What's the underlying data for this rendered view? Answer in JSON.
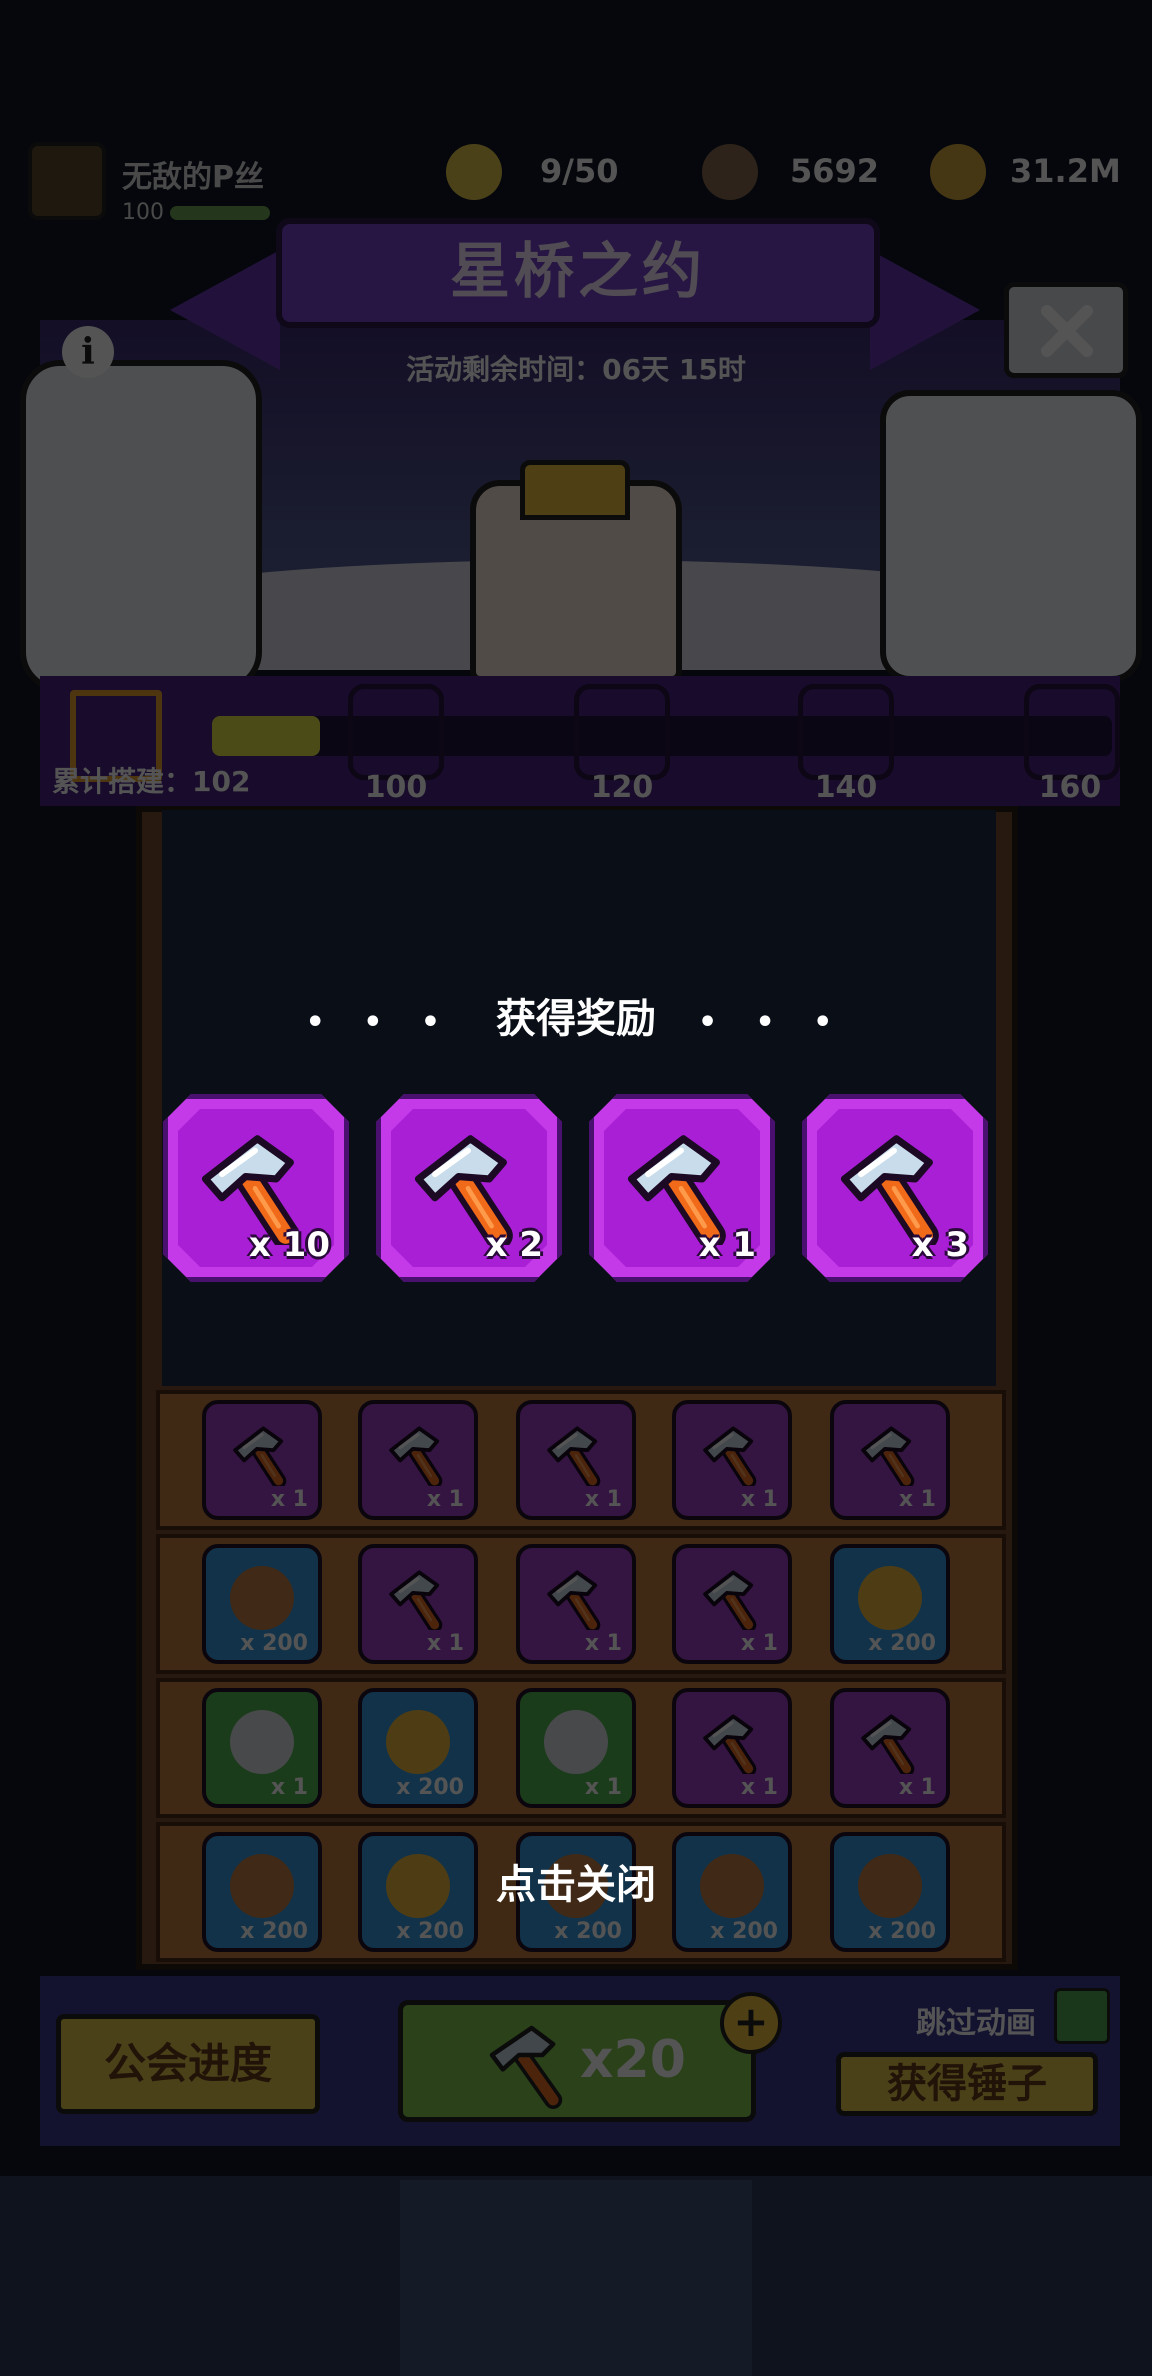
{
  "player": {
    "name": "无敌的P丝",
    "level": "100"
  },
  "resources": [
    {
      "icon": "energy-icon",
      "value": "9/50"
    },
    {
      "icon": "gem-icon",
      "value": "5692"
    },
    {
      "icon": "coin-icon",
      "value": "31.2M"
    }
  ],
  "event": {
    "title": "星桥之约",
    "countdown": "活动剩余时间：06天 15时",
    "built_label": "累计搭建：102",
    "progress_fraction": 0.12,
    "milestones": [
      {
        "value": "100",
        "icon": "fish-bone-icon",
        "color": "#a43ad0"
      },
      {
        "value": "120",
        "icon": "chest-icon",
        "color": "#e8c640"
      },
      {
        "value": "140",
        "icon": "key-icon",
        "color": "#e8c640"
      },
      {
        "value": "160",
        "icon": "sword-icon",
        "color": "#e8c640"
      }
    ]
  },
  "grid": [
    [
      {
        "icon": "hammer-icon",
        "count": "x 1",
        "color": "#a43ad0"
      },
      {
        "icon": "hammer-icon",
        "count": "x 1",
        "color": "#a43ad0"
      },
      {
        "icon": "hammer-icon",
        "count": "x 1",
        "color": "#a43ad0"
      },
      {
        "icon": "hammer-icon",
        "count": "x 1",
        "color": "#a43ad0"
      },
      {
        "icon": "hammer-icon",
        "count": "x 1",
        "color": "#a43ad0"
      }
    ],
    [
      {
        "icon": "coin-face-icon",
        "count": "x 200",
        "color": "#2a9ae8"
      },
      {
        "icon": "hammer-icon",
        "count": "x 1",
        "color": "#a43ad0"
      },
      {
        "icon": "hammer-icon",
        "count": "x 1",
        "color": "#a43ad0"
      },
      {
        "icon": "hammer-icon",
        "count": "x 1",
        "color": "#a43ad0"
      },
      {
        "icon": "drop-icon",
        "count": "x 200",
        "color": "#2a9ae8"
      }
    ],
    [
      {
        "icon": "chest-icon",
        "count": "x 1",
        "color": "#4ab84a"
      },
      {
        "icon": "drop-icon",
        "count": "x 200",
        "color": "#2a9ae8"
      },
      {
        "icon": "chest-icon",
        "count": "x 1",
        "color": "#4ab84a"
      },
      {
        "icon": "hammer-icon",
        "count": "x 1",
        "color": "#a43ad0"
      },
      {
        "icon": "hammer-icon",
        "count": "x 1",
        "color": "#a43ad0"
      }
    ],
    [
      {
        "icon": "coin-face-icon",
        "count": "x 200",
        "color": "#2a9ae8"
      },
      {
        "icon": "drop-icon",
        "count": "x 200",
        "color": "#2a9ae8"
      },
      {
        "icon": "coin-face-icon",
        "count": "x 200",
        "color": "#2a9ae8"
      },
      {
        "icon": "coin-face-icon",
        "count": "x 200",
        "color": "#2a9ae8"
      },
      {
        "icon": "coin-face-icon",
        "count": "x 200",
        "color": "#2a9ae8"
      }
    ]
  ],
  "bottom": {
    "guild_progress": "公会进度",
    "smash_count": "x20",
    "skip_animation": "跳过动画",
    "get_hammer": "获得锤子"
  },
  "overlay": {
    "dots_left": "• • •",
    "title": "获得奖励",
    "dots_right": "• • •",
    "rewards": [
      {
        "icon": "hammer-icon",
        "count": "x 10"
      },
      {
        "icon": "hammer-icon",
        "count": "x 2"
      },
      {
        "icon": "hammer-icon",
        "count": "x 1"
      },
      {
        "icon": "hammer-icon",
        "count": "x 3"
      }
    ],
    "tap_to_close": "点击关闭"
  },
  "colors": {
    "reward_card": "#c53ae8",
    "reward_card_inner": "#a81fd6",
    "overlay_bg": "#05070c"
  }
}
